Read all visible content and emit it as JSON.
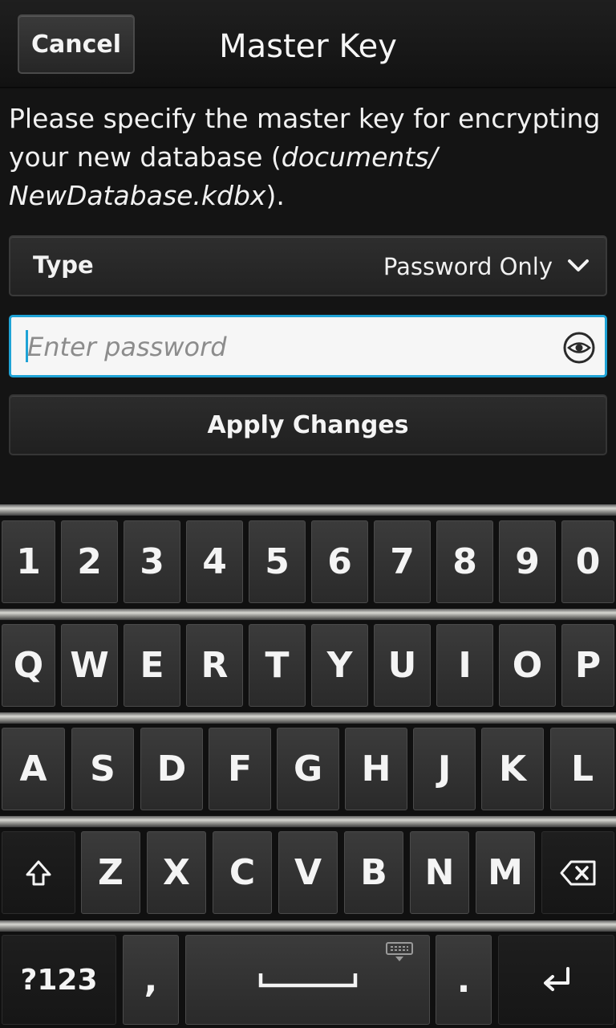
{
  "header": {
    "cancel_label": "Cancel",
    "title": "Master Key"
  },
  "instructions": {
    "prefix": "Please specify the master key for encrypting your new database (",
    "path": "documents/​NewDatabase.kdbx",
    "suffix": ")."
  },
  "type_row": {
    "label": "Type",
    "value": "Password Only",
    "chevron_icon": "chevron-down-icon"
  },
  "password_field": {
    "placeholder": "Enter password",
    "value": "",
    "toggle_icon": "eye-icon"
  },
  "apply_label": "Apply Changes",
  "keyboard": {
    "row1": [
      "1",
      "2",
      "3",
      "4",
      "5",
      "6",
      "7",
      "8",
      "9",
      "0"
    ],
    "row2": [
      "Q",
      "W",
      "E",
      "R",
      "T",
      "Y",
      "U",
      "I",
      "O",
      "P"
    ],
    "row3": [
      "A",
      "S",
      "D",
      "F",
      "G",
      "H",
      "J",
      "K",
      "L"
    ],
    "row4_letters": [
      "Z",
      "X",
      "C",
      "V",
      "B",
      "N",
      "M"
    ],
    "shift_icon": "shift-icon",
    "backspace_icon": "backspace-icon",
    "symbols_label": "?123",
    "comma_label": ",",
    "space_icon": "space-bar-icon",
    "keyboard_hint_icon": "keyboard-hide-icon",
    "period_label": ".",
    "enter_icon": "enter-icon"
  },
  "colors": {
    "accent": "#1fa3d6",
    "background": "#141414"
  }
}
